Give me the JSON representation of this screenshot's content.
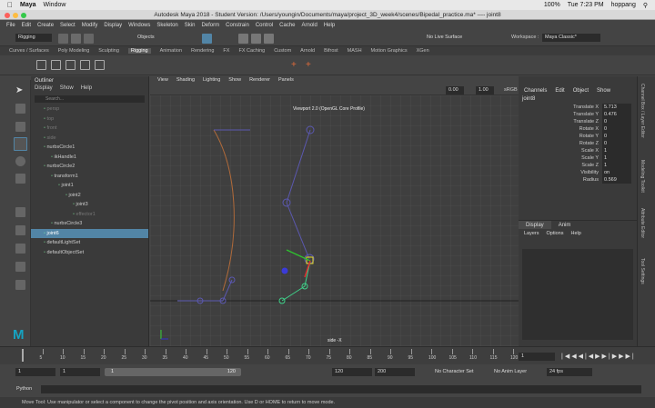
{
  "macbar": {
    "app": "Maya",
    "window": "Window",
    "battery": "100%",
    "clock": "Tue 7:23 PM",
    "user": "hoppang"
  },
  "title": "Autodesk Maya 2018 - Student Version: /Users/youngin/Documents/maya/project_3D_week4/scenes/Bipedal_practice.ma*  ----  joint8",
  "menu": [
    "File",
    "Edit",
    "Create",
    "Select",
    "Modify",
    "Display",
    "Windows",
    "Skeleton",
    "Skin",
    "Deform",
    "Constrain",
    "Control",
    "Cache",
    "Arnold",
    "Help"
  ],
  "status": {
    "menuset": "Rigging",
    "objects": "Objects",
    "live": "No Live Surface",
    "workspace_label": "Workspace :",
    "workspace": "Maya Classic*"
  },
  "shelf_tabs": [
    "Curves / Surfaces",
    "Poly Modeling",
    "Sculpting",
    "Rigging",
    "Animation",
    "Rendering",
    "FX",
    "FX Caching",
    "Custom",
    "Arnold",
    "Bifrost",
    "MASH",
    "Motion Graphics",
    "XGen"
  ],
  "active_shelf": "Rigging",
  "outliner": {
    "title": "Outliner",
    "menu": [
      "Display",
      "Show",
      "Help"
    ],
    "search": "Search...",
    "items": [
      {
        "label": "persp",
        "dim": true
      },
      {
        "label": "top",
        "dim": true
      },
      {
        "label": "front",
        "dim": true
      },
      {
        "label": "side",
        "dim": true
      },
      {
        "label": "nurbsCircle1",
        "dim": false
      },
      {
        "label": "ikHandle1",
        "dim": false
      },
      {
        "label": "nurbsCircle2",
        "dim": false
      },
      {
        "label": "transform1",
        "dim": false
      },
      {
        "label": "joint1",
        "dim": false
      },
      {
        "label": "joint2",
        "dim": false
      },
      {
        "label": "joint3",
        "dim": false
      },
      {
        "label": "effector1",
        "dim": true
      },
      {
        "label": "nurbsCircle3",
        "dim": false
      },
      {
        "label": "joint6",
        "dim": false,
        "selected": true
      },
      {
        "label": "defaultLightSet",
        "dim": false
      },
      {
        "label": "defaultObjectSet",
        "dim": false
      }
    ]
  },
  "viewport": {
    "menu": [
      "View",
      "Shading",
      "Lighting",
      "Show",
      "Renderer",
      "Panels"
    ],
    "renderer_label": "Viewport 2.0 (OpenGL Core Profile)",
    "camera_label": "side -X",
    "field1": "0.00",
    "field2": "1.00",
    "color_space": "sRGB"
  },
  "channel_box": {
    "menu": [
      "Channels",
      "Edit",
      "Object",
      "Show"
    ],
    "node": "joint8",
    "attrs": [
      {
        "name": "Translate X",
        "value": "5.713"
      },
      {
        "name": "Translate Y",
        "value": "0.476"
      },
      {
        "name": "Translate Z",
        "value": "0"
      },
      {
        "name": "Rotate X",
        "value": "0"
      },
      {
        "name": "Rotate Y",
        "value": "0"
      },
      {
        "name": "Rotate Z",
        "value": "0"
      },
      {
        "name": "Scale X",
        "value": "1"
      },
      {
        "name": "Scale Y",
        "value": "1"
      },
      {
        "name": "Scale Z",
        "value": "1"
      },
      {
        "name": "Visibility",
        "value": "on"
      },
      {
        "name": "Radius",
        "value": "0.569"
      }
    ],
    "layer_tabs": [
      "Display",
      "Anim"
    ],
    "layer_menu": [
      "Layers",
      "Options",
      "Help"
    ]
  },
  "right_tabs": [
    "Channel Box / Layer Editor",
    "Modeling Toolkit",
    "Attribute Editor",
    "Tool Settings"
  ],
  "timeline": {
    "ticks": [
      "5",
      "10",
      "15",
      "20",
      "25",
      "30",
      "35",
      "40",
      "45",
      "50",
      "55",
      "60",
      "65",
      "70",
      "75",
      "80",
      "85",
      "90",
      "95",
      "100",
      "105",
      "110",
      "115",
      "120"
    ],
    "current": "1"
  },
  "range": {
    "start": "1",
    "start2": "1",
    "slider_start": "1",
    "slider_end": "120",
    "end": "120",
    "end2": "200",
    "char_set": "No Character Set",
    "anim_layer": "No Anim Layer",
    "fps": "24 fps"
  },
  "python": {
    "label": "Python"
  },
  "help_line": "Move Tool: Use manipulator or select a component to change the pivot position and axis orientation. Use D or HOME to return to move mode."
}
